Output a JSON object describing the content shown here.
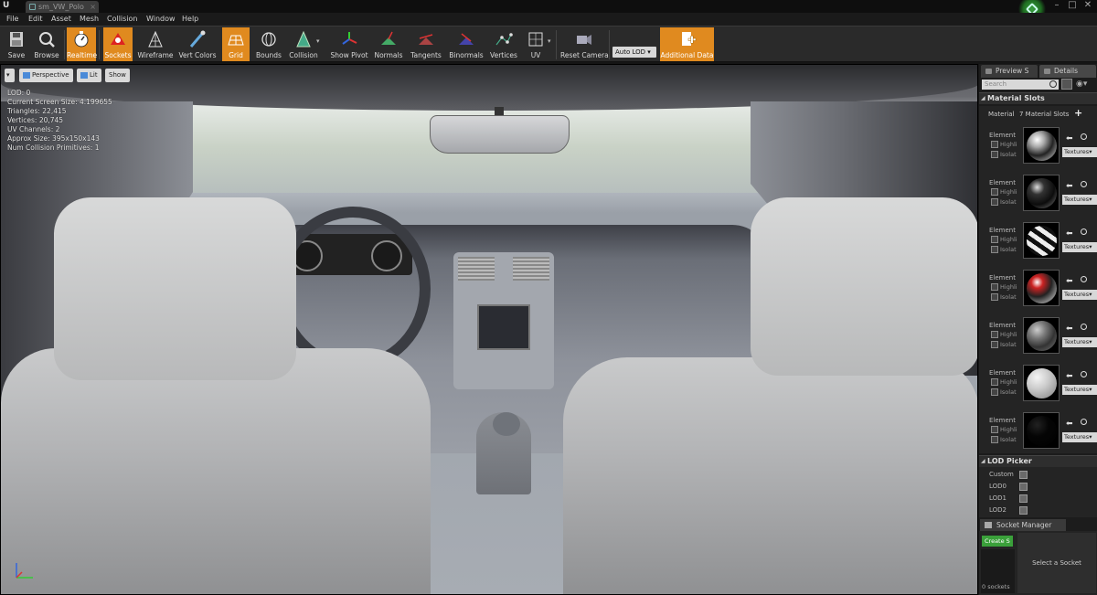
{
  "window": {
    "tab_title": "sm_VW_Polo",
    "engine_logo": "U",
    "minimize": "–",
    "maximize": "□",
    "close": "✕"
  },
  "menu": [
    "File",
    "Edit",
    "Asset",
    "Mesh",
    "Collision",
    "Window",
    "Help"
  ],
  "toolbar": {
    "save": "Save",
    "browse": "Browse",
    "realtime": "Realtime",
    "sockets": "Sockets",
    "wireframe": "Wireframe",
    "vert_colors": "Vert Colors",
    "grid": "Grid",
    "bounds": "Bounds",
    "collision": "Collision",
    "show_pivot": "Show Pivot",
    "normals": "Normals",
    "tangents": "Tangents",
    "binormals": "Binormals",
    "vertices": "Vertices",
    "uv": "UV",
    "reset_camera": "Reset Camera",
    "lod_select": "Auto LOD",
    "additional_data": "Additional Data",
    "accent": "#e08a1f"
  },
  "viewport": {
    "perspective": "Perspective",
    "lit": "Lit",
    "show": "Show",
    "stats": [
      "LOD: 0",
      "Current Screen Size: 4.199655",
      "Triangles: 22,415",
      "Vertices: 20,745",
      "UV Channels: 2",
      "Approx Size: 395x150x143",
      "Num Collision Primitives: 1"
    ]
  },
  "right_panel": {
    "tab_preview": "Preview S",
    "tab_details": "Details",
    "search_placeholder": "Search",
    "material_slots_title": "Material Slots",
    "material_label": "Material",
    "material_count": "7 Material Slots",
    "add": "+",
    "highlight_label": "Highli",
    "isolate_label": "Isolat",
    "textures_label": "Textures",
    "elements": [
      {
        "name": "Element",
        "sphere": "chrome"
      },
      {
        "name": "Element",
        "sphere": "dark"
      },
      {
        "name": "Element",
        "sphere": "stripes"
      },
      {
        "name": "Element",
        "sphere": "red"
      },
      {
        "name": "Element",
        "sphere": "grey"
      },
      {
        "name": "Element",
        "sphere": "white"
      },
      {
        "name": "Element",
        "sphere": "black"
      }
    ],
    "lod_picker_title": "LOD Picker",
    "lod_rows": [
      "Custom",
      "LOD0",
      "LOD1",
      "LOD2"
    ],
    "socket_manager": "Socket Manager",
    "create_socket": "Create S",
    "socket_count": "0 sockets",
    "select_socket": "Select a Socket"
  }
}
